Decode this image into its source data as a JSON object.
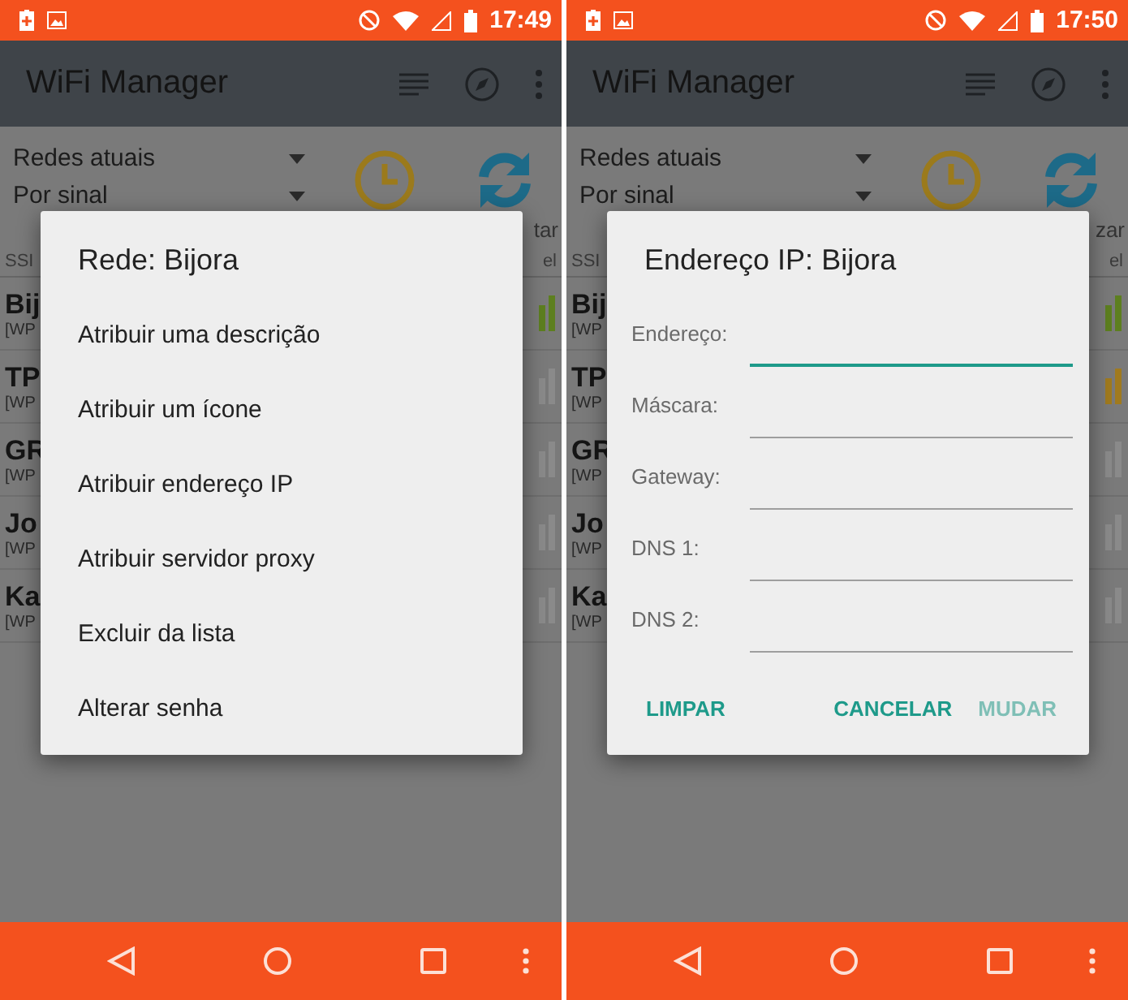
{
  "screens": [
    {
      "status_bar": {
        "time": "17:49"
      },
      "app_bar": {
        "title": "WiFi Manager"
      },
      "filters": [
        {
          "label": "Redes atuais"
        },
        {
          "label": "Por sinal"
        }
      ],
      "refresh_label": "tar",
      "list_header": {
        "column_1": "SSI",
        "column_2": "el"
      },
      "rows": [
        {
          "name": "Bij",
          "detail": "[WP",
          "color": "#5d7f1f"
        },
        {
          "name": "TP",
          "detail": "[WP",
          "color": "#8a8a8a"
        },
        {
          "name": "GR",
          "detail": "[WP",
          "color": "#8a8a8a"
        },
        {
          "name": "Jo",
          "detail": "[WP",
          "color": "#8a8a8a"
        },
        {
          "name": "Ka",
          "detail": "[WP",
          "color": "#8a8a8a"
        }
      ],
      "dialog": {
        "kind": "menu",
        "title": "Rede: Bijora",
        "items": [
          {
            "label": "Atribuir uma descrição"
          },
          {
            "label": "Atribuir um ícone"
          },
          {
            "label": "Atribuir endereço IP"
          },
          {
            "label": "Atribuir servidor proxy"
          },
          {
            "label": "Excluir da lista"
          },
          {
            "label": "Alterar senha"
          }
        ]
      }
    },
    {
      "status_bar": {
        "time": "17:50"
      },
      "app_bar": {
        "title": "WiFi Manager"
      },
      "filters": [
        {
          "label": "Redes atuais"
        },
        {
          "label": "Por sinal"
        }
      ],
      "refresh_label": "zar",
      "list_header": {
        "column_1": "SSI",
        "column_2": "el"
      },
      "rows": [
        {
          "name": "Bij",
          "detail": "[WP",
          "color": "#5d7f1f"
        },
        {
          "name": "TP",
          "detail": "[WP",
          "color": "#a07a1e"
        },
        {
          "name": "GR",
          "detail": "[WP",
          "color": "#8a8a8a"
        },
        {
          "name": "Jo",
          "detail": "[WP",
          "color": "#8a8a8a"
        },
        {
          "name": "Ka",
          "detail": "[WP",
          "color": "#8a8a8a"
        }
      ],
      "dialog": {
        "kind": "form",
        "title": "Endereço IP: Bijora",
        "fields": [
          {
            "label": "Endereço:",
            "focused": true
          },
          {
            "label": "Máscara:",
            "focused": false
          },
          {
            "label": "Gateway:",
            "focused": false
          },
          {
            "label": "DNS 1:",
            "focused": false
          },
          {
            "label": "DNS 2:",
            "focused": false
          }
        ],
        "buttons": [
          {
            "label": "LIMPAR",
            "disabled": false
          },
          {
            "label": "CANCELAR",
            "disabled": false
          },
          {
            "label": "MUDAR",
            "disabled": true
          }
        ]
      }
    }
  ]
}
